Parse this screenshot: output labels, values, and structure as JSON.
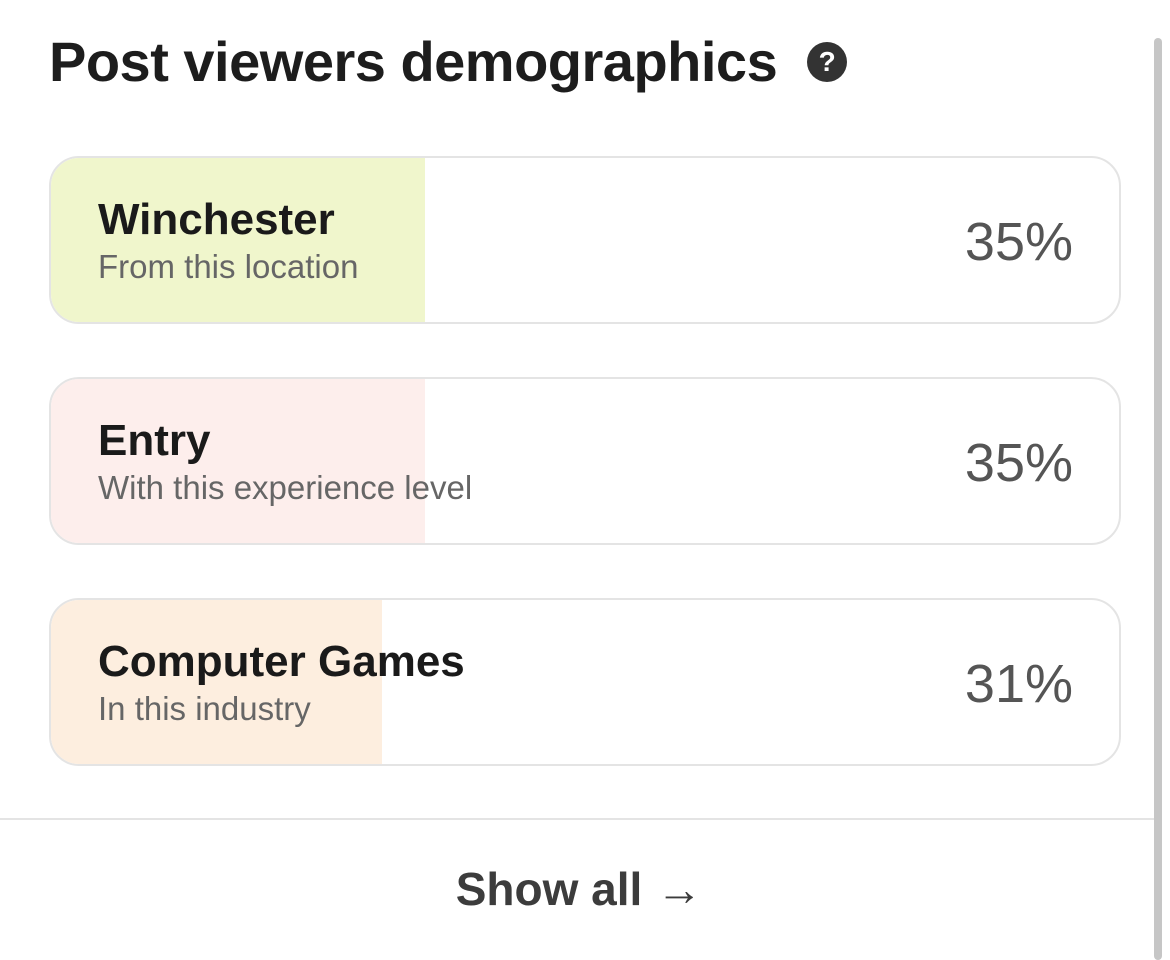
{
  "header": {
    "title": "Post viewers demographics",
    "help_icon": "question-circle-icon"
  },
  "cards": [
    {
      "label": "Winchester",
      "sub": "From this location",
      "percent": "35%",
      "value": 35,
      "fill_color": "#f0f6cc"
    },
    {
      "label": "Entry",
      "sub": "With this experience level",
      "percent": "35%",
      "value": 35,
      "fill_color": "#fdeeec"
    },
    {
      "label": "Computer Games",
      "sub": "In this industry",
      "percent": "31%",
      "value": 31,
      "fill_color": "#fdeedf"
    }
  ],
  "footer": {
    "show_all_label": "Show all",
    "arrow": "→"
  }
}
